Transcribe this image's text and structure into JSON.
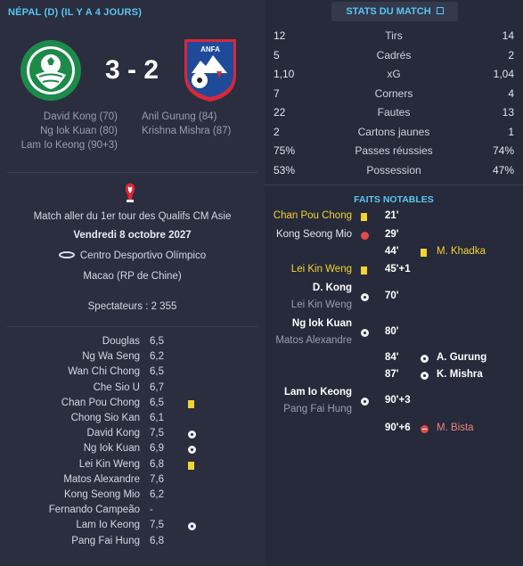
{
  "header": {
    "title": "NÉPAL (D) (IL Y A 4 JOURS)"
  },
  "score": {
    "text": "3 - 2"
  },
  "crests": {
    "away_text": "ANFA"
  },
  "scorers": {
    "home": [
      "David Kong (70)",
      "Ng Iok Kuan (80)",
      "Lam Io Keong (90+3)"
    ],
    "away": [
      "Anil Gurung (84)",
      "Krishna Mishra (87)"
    ]
  },
  "match_info": {
    "competition": "Match aller du 1er tour des Qualifs CM Asie",
    "date": "Vendredi 8 octobre 2027",
    "stadium": "Centro Desportivo Olímpico",
    "city": "Macao (RP de Chine)",
    "spectators": "Spectateurs : 2 355"
  },
  "players": [
    {
      "name": "Douglas",
      "rating": "6,5",
      "icon": ""
    },
    {
      "name": "Ng Wa Seng",
      "rating": "6,2",
      "icon": ""
    },
    {
      "name": "Wan Chi Chong",
      "rating": "6,5",
      "icon": ""
    },
    {
      "name": "Che Sio U",
      "rating": "6,7",
      "icon": ""
    },
    {
      "name": "Chan Pou Chong",
      "rating": "6,5",
      "icon": "yellow-card"
    },
    {
      "name": "Chong Sio Kan",
      "rating": "6,1",
      "icon": ""
    },
    {
      "name": "David Kong",
      "rating": "7,5",
      "icon": "ball"
    },
    {
      "name": "Ng Iok Kuan",
      "rating": "6,9",
      "icon": "ball"
    },
    {
      "name": "Lei Kin Weng",
      "rating": "6,8",
      "icon": "yellow-card"
    },
    {
      "name": "Matos Alexandre",
      "rating": "7,6",
      "icon": ""
    },
    {
      "name": "Kong Seong Mio",
      "rating": "6,2",
      "icon": ""
    },
    {
      "name": "Fernando Campeão",
      "rating": "-",
      "icon": ""
    },
    {
      "name": "Lam Io Keong",
      "rating": "7,5",
      "icon": "ball"
    },
    {
      "name": "Pang Fai Hung",
      "rating": "6,8",
      "icon": ""
    }
  ],
  "stats": {
    "header": "STATS DU MATCH",
    "rows": [
      {
        "label": "Tirs",
        "home": "12",
        "away": "14"
      },
      {
        "label": "Cadrés",
        "home": "5",
        "away": "2"
      },
      {
        "label": "xG",
        "home": "1,10",
        "away": "1,04"
      },
      {
        "label": "Corners",
        "home": "7",
        "away": "4"
      },
      {
        "label": "Fautes",
        "home": "22",
        "away": "13"
      },
      {
        "label": "Cartons jaunes",
        "home": "2",
        "away": "1"
      },
      {
        "label": "Passes réussies",
        "home": "75%",
        "away": "74%"
      },
      {
        "label": "Possession",
        "home": "53%",
        "away": "47%"
      }
    ]
  },
  "events": {
    "title": "FAITS NOTABLES",
    "items": [
      {
        "home": [
          "Chan Pou Chong"
        ],
        "icon": "yellow-card",
        "time": "21'",
        "away": ""
      },
      {
        "home": [
          "Kong Seong Mio"
        ],
        "icon": "injury",
        "time": "29'",
        "away": ""
      },
      {
        "home": [],
        "icon": "",
        "time": "44'",
        "away": "M. Khadka",
        "away_icon": "yellow-card"
      },
      {
        "home": [
          "Lei Kin Weng"
        ],
        "icon": "yellow-card",
        "time": "45'+1",
        "away": ""
      },
      {
        "home": [
          "D. Kong",
          "Lei Kin Weng"
        ],
        "icon": "ball",
        "time": "70'",
        "away": ""
      },
      {
        "home": [
          "Ng Iok Kuan",
          "Matos Alexandre"
        ],
        "icon": "ball",
        "time": "80'",
        "away": ""
      },
      {
        "home": [],
        "icon": "",
        "time": "84'",
        "away": "A. Gurung",
        "away_icon": "ball"
      },
      {
        "home": [],
        "icon": "",
        "time": "87'",
        "away": "K. Mishra",
        "away_icon": "ball"
      },
      {
        "home": [
          "Lam Io Keong",
          "Pang Fai Hung"
        ],
        "icon": "ball",
        "time": "90'+3",
        "away": ""
      },
      {
        "home": [],
        "icon": "",
        "time": "90'+6",
        "away": "M. Bista",
        "away_icon": "sub"
      }
    ]
  },
  "colors": {
    "accent": "#59c6f2",
    "yellow_card": "#f3d432",
    "red": "#e24b4b",
    "background": "#262a3a"
  }
}
